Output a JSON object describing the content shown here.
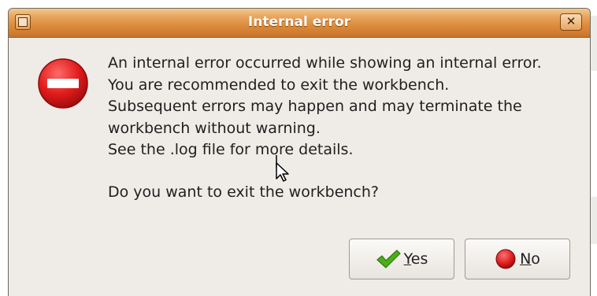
{
  "dialog": {
    "title": "Internal error",
    "close_glyph": "✕",
    "message_lines": [
      "An internal error occurred while showing an internal error.",
      "You are recommended to exit the workbench.",
      "Subsequent errors may happen and may terminate the",
      "workbench without warning.",
      "See the .log file for more details."
    ],
    "question": "Do you want to exit the workbench?",
    "buttons": {
      "yes": {
        "mnemonic": "Y",
        "rest": "es",
        "icon": "checkmark-icon"
      },
      "no": {
        "mnemonic": "N",
        "rest": "o",
        "icon": "stop-icon"
      }
    }
  },
  "colors": {
    "titlebar": "#dc8b3c",
    "error_icon": "#d81e1e",
    "check": "#4caf1a"
  }
}
